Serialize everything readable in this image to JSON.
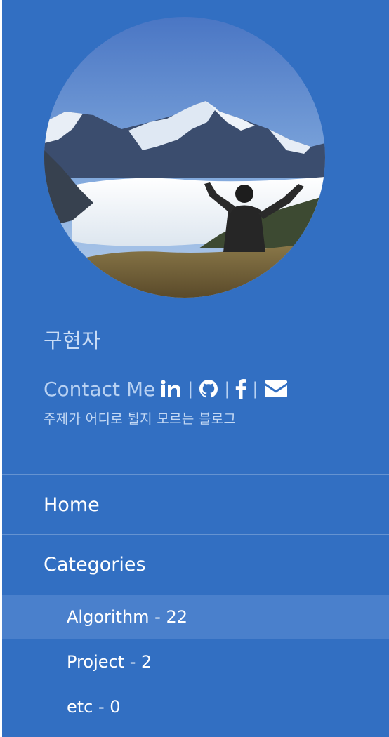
{
  "profile": {
    "name": "구현자",
    "contact_label": "Contact Me",
    "separator": "|",
    "tagline": "주제가 어디로 튈지 모르는 블로그",
    "social_links": [
      {
        "icon": "linkedin-icon"
      },
      {
        "icon": "github-icon"
      },
      {
        "icon": "facebook-icon"
      },
      {
        "icon": "email-icon"
      }
    ]
  },
  "nav": {
    "home_label": "Home",
    "categories_label": "Categories",
    "categories": [
      {
        "label": "Algorithm - 22",
        "active": true
      },
      {
        "label": "Project - 2",
        "active": false
      },
      {
        "label": "etc - 0",
        "active": false
      }
    ]
  },
  "colors": {
    "sidebar_bg": "#326fc2",
    "active_item_bg": "#4a80cc",
    "muted_text": "#b8d1f2"
  }
}
